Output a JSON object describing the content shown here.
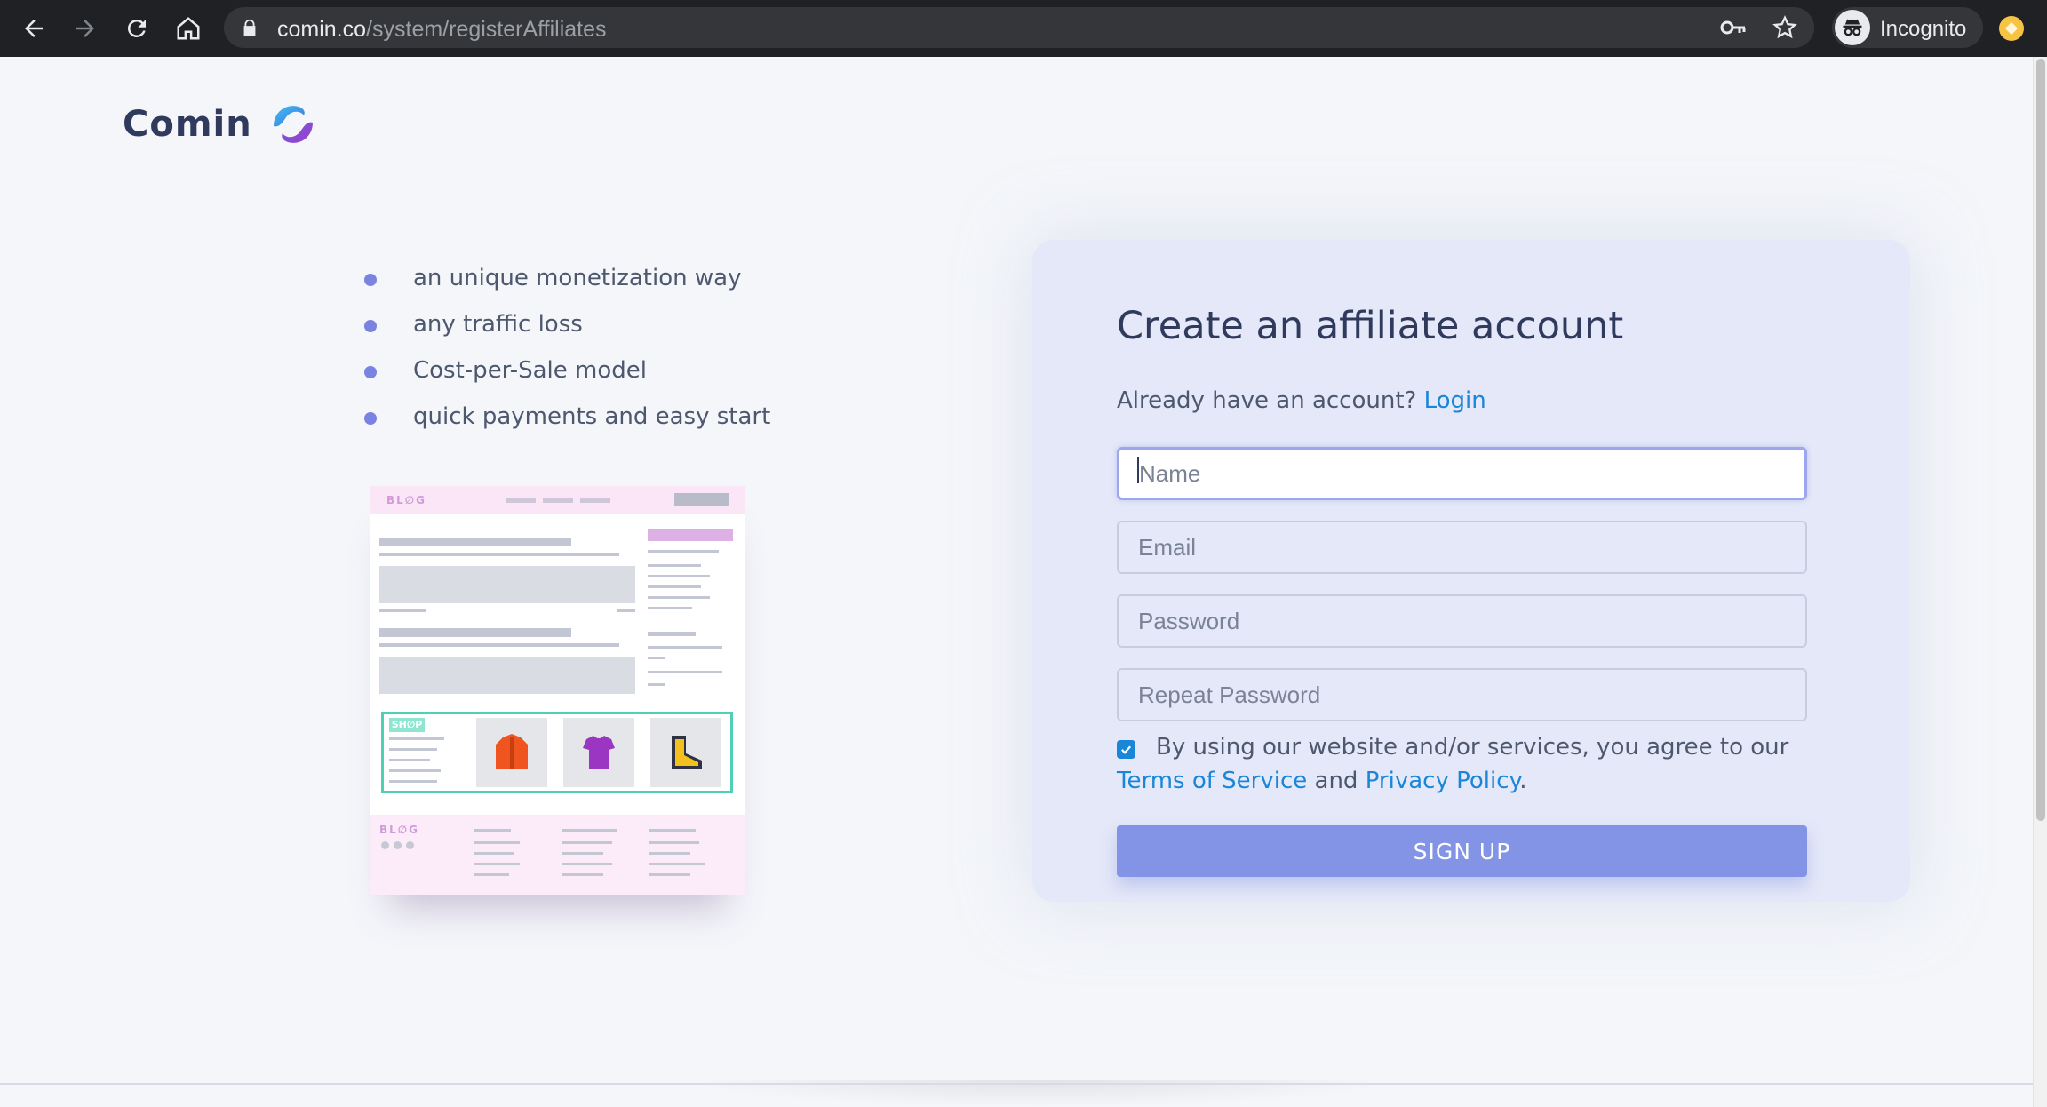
{
  "browser": {
    "url_host": "comin.co",
    "url_path": "/system/registerAffiliates",
    "profile_label": "Incognito",
    "icons": [
      "back-icon",
      "forward-icon",
      "reload-icon",
      "home-icon",
      "lock-icon",
      "key-icon",
      "star-icon",
      "incognito-icon",
      "extension-icon"
    ]
  },
  "logo": {
    "text": "Comin"
  },
  "features": [
    "an unique monetization way",
    "any traffic loss",
    "Cost-per-Sale model",
    "quick payments and easy start"
  ],
  "illustration": {
    "blog_label": "BL∅G",
    "shop_label": "SH∅P"
  },
  "form": {
    "title": "Create an affiliate account",
    "have_account_text": "Already have an account?",
    "login_link": "Login",
    "name_placeholder": "Name",
    "email_placeholder": "Email",
    "password_placeholder": "Password",
    "repeat_password_placeholder": "Repeat Password",
    "agree_checked": true,
    "terms_prefix": "By using our website and/or services, you agree to our",
    "terms_link": "Terms of Service",
    "terms_and": "and",
    "privacy_link": "Privacy Policy",
    "terms_suffix": ".",
    "signup_label": "SIGN UP"
  },
  "colors": {
    "accent": "#8394e6",
    "link": "#1a86d8",
    "bullet": "#7a84e0",
    "card_bg": "#e4e8f8",
    "page_bg": "#f4f6fa"
  }
}
